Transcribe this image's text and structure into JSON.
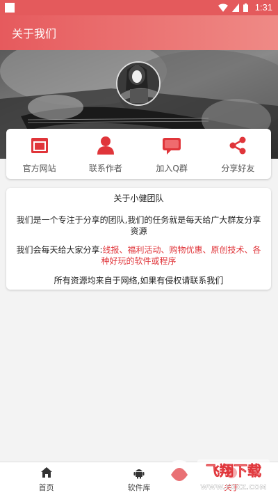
{
  "status_bar": {
    "time": "1:31"
  },
  "app_bar": {
    "title": "关于我们"
  },
  "actions": [
    {
      "label": "官方网站",
      "icon": "browser-window-icon"
    },
    {
      "label": "联系作者",
      "icon": "person-icon"
    },
    {
      "label": "加入Q群",
      "icon": "chat-bubble-icon"
    },
    {
      "label": "分享好友",
      "icon": "share-icon"
    }
  ],
  "about": {
    "title": "关于小健团队",
    "para1": "我们是一个专注于分享的团队,我们的任务就是每天给广大群友分享资源",
    "para2_prefix": "我们会每天给大家分享:",
    "para2_highlight": "线报、福利活动、购物优惠、原创技术、各种好玩的软件或程序",
    "footer": "所有资源均来自于网络,如果有侵权请联系我们"
  },
  "tabs": [
    {
      "label": "首页",
      "icon": "home-icon"
    },
    {
      "label": "软件库",
      "icon": "android-icon"
    },
    {
      "label": "关于",
      "icon": "info-icon"
    }
  ],
  "watermark": {
    "text": "飞翔下载",
    "url": "WWW.FXXZ.COM"
  },
  "colors": {
    "accent": "#e45a5c",
    "highlight": "#e0353a"
  }
}
